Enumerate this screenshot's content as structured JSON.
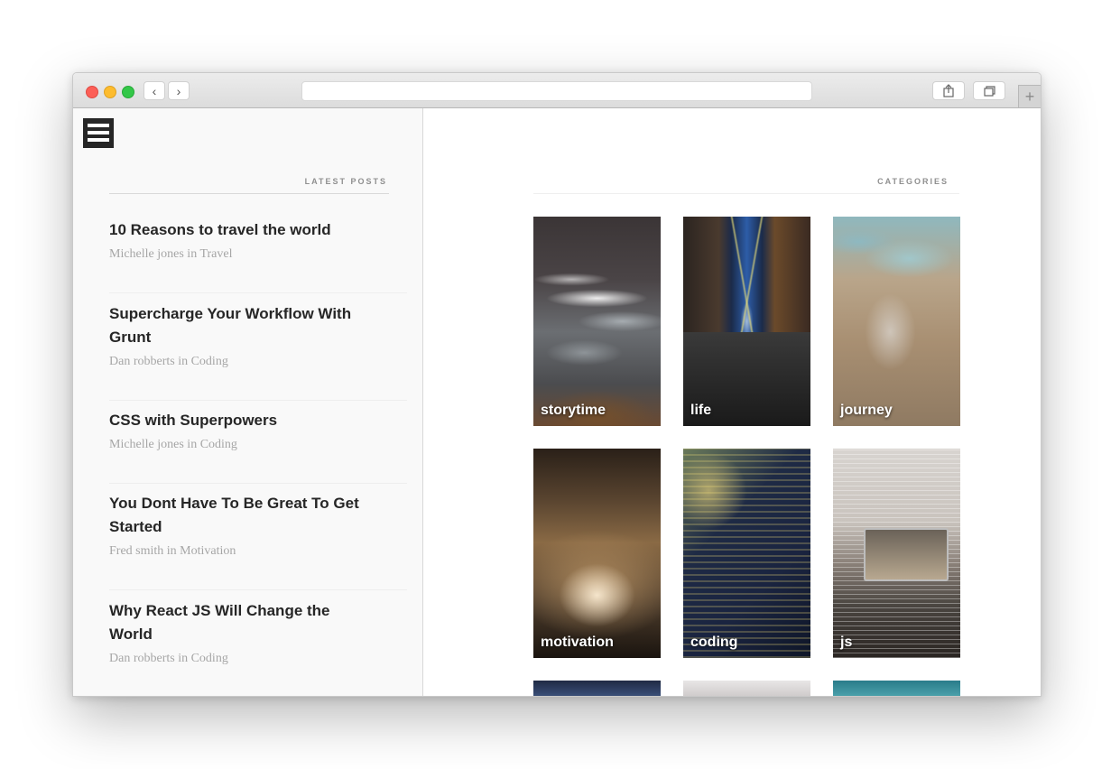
{
  "browser": {
    "back_glyph": "‹",
    "forward_glyph": "›",
    "new_tab_glyph": "+",
    "url": ""
  },
  "sidebar": {
    "menu_icon": "hamburger-menu-icon",
    "heading": "LATEST POSTS",
    "posts": [
      {
        "title": "10 Reasons to travel the world",
        "meta": "Michelle jones in Travel"
      },
      {
        "title": "Supercharge Your Workflow With Grunt",
        "meta": "Dan robberts in Coding"
      },
      {
        "title": "CSS with Superpowers",
        "meta": "Michelle jones in Coding"
      },
      {
        "title": "You Dont Have To Be Great To Get Started",
        "meta": "Fred smith in Motivation"
      },
      {
        "title": "Why React JS Will Change the World",
        "meta": "Dan robberts in Coding"
      }
    ]
  },
  "main": {
    "heading": "CATEGORIES",
    "categories": [
      {
        "label": "storytime"
      },
      {
        "label": "life"
      },
      {
        "label": "journey"
      },
      {
        "label": "motivation"
      },
      {
        "label": "coding"
      },
      {
        "label": "js"
      }
    ]
  },
  "colors": {
    "sidebar_bg": "#f9f9f9",
    "title_text": "#262626",
    "meta_text": "#a6a6a6",
    "heading_text": "#8f8f8f",
    "traffic_red": "#fc5f57",
    "traffic_yellow": "#fdbc2e",
    "traffic_green": "#33c748"
  }
}
